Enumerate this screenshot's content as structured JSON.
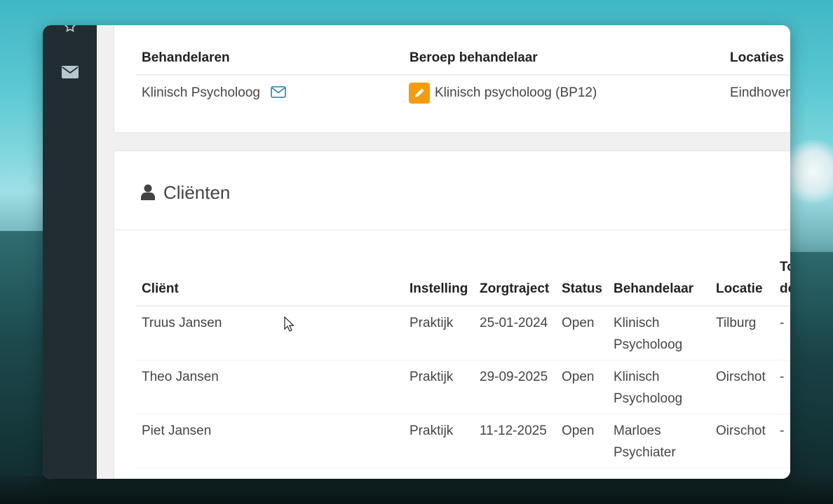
{
  "behandelaren_table": {
    "headers": {
      "behandelaren": "Behandelaren",
      "beroep": "Beroep behandelaar",
      "locaties": "Locaties"
    },
    "row": {
      "behandelaar": "Klinisch Psycholoog",
      "beroep": "Klinisch psycholoog (BP12)",
      "locatie": "Eindhoven"
    }
  },
  "clienten": {
    "title": "Cliënten",
    "headers": {
      "client": "Cliënt",
      "instelling": "Instelling",
      "zorgtraject": "Zorgtraject",
      "status": "Status",
      "behandelaar": "Behandelaar",
      "locatie": "Locatie",
      "extra_line1": "To",
      "extra_line2": "do"
    },
    "rows": [
      {
        "client": "Truus Jansen",
        "instelling": "Praktijk",
        "zorgtraject": "25-01-2024",
        "status": "Open",
        "behandelaar_line1": "Klinisch",
        "behandelaar_line2": "Psycholoog",
        "locatie": "Tilburg",
        "extra": "-"
      },
      {
        "client": "Theo Jansen",
        "instelling": "Praktijk",
        "zorgtraject": "29-09-2025",
        "status": "Open",
        "behandelaar_line1": "Klinisch",
        "behandelaar_line2": "Psycholoog",
        "locatie": "Oirschot",
        "extra": "-"
      },
      {
        "client": "Piet Jansen",
        "instelling": "Praktijk",
        "zorgtraject": "11-12-2025",
        "status": "Open",
        "behandelaar_line1": "Marloes",
        "behandelaar_line2": "Psychiater",
        "locatie": "Oirschot",
        "extra": "-"
      }
    ]
  },
  "icons": {
    "sidebar": [
      "star-icon",
      "envelope-icon"
    ],
    "behandelaar_mail": "envelope-outline-icon",
    "edit": "pencil-icon",
    "section": "user-icon"
  },
  "colors": {
    "sidebar": "#222d32",
    "edit_badge": "#f39c12",
    "mail_link": "#3c8dbc"
  }
}
